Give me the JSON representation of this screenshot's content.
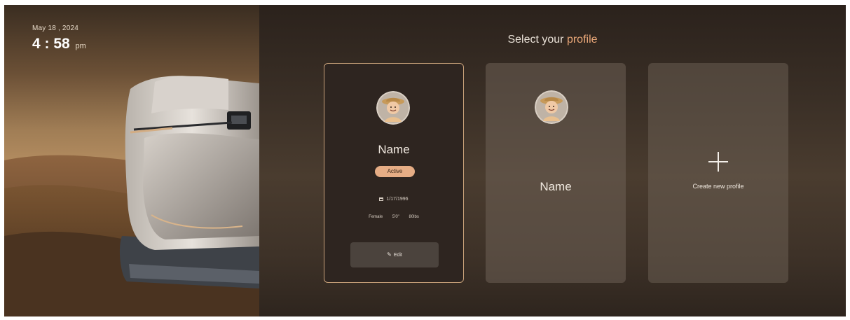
{
  "hero": {
    "date": "May 18 , 2024",
    "time": "4 : 58",
    "ampm": "pm"
  },
  "header": {
    "title_prefix": "Select your",
    "title_accent": "profile"
  },
  "profiles": [
    {
      "name": "Name",
      "status": "Active",
      "birthdate": "1/17/1996",
      "gender": "Female",
      "height": "5'0\"",
      "weight": "80lbs",
      "edit_label": "Edit",
      "avatar_icon": "user-avatar-icon"
    },
    {
      "name": "Name",
      "avatar_icon": "user-avatar-icon"
    }
  ],
  "create": {
    "label": "Create new profile",
    "icon": "plus-icon"
  },
  "colors": {
    "accent": "#e9a778",
    "badge": "#e6ad85",
    "active_border": "#c9a27a"
  }
}
